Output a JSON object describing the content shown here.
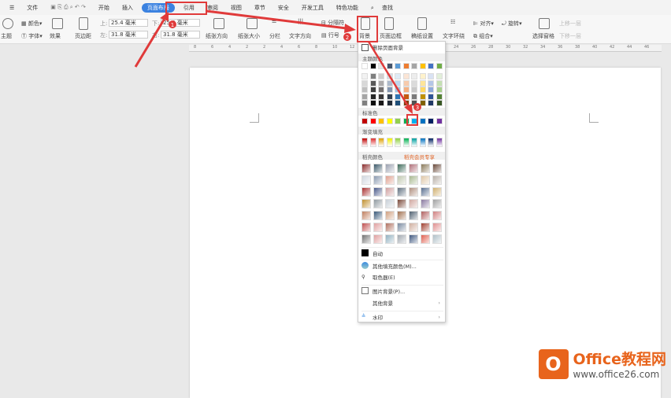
{
  "tabs": {
    "file": "文件",
    "items": [
      "开始",
      "插入",
      "页面布局",
      "引用",
      "审阅",
      "视图",
      "章节",
      "安全",
      "开发工具",
      "特色功能"
    ],
    "search": "查找"
  },
  "toolbar": {
    "theme": "主题",
    "colors": "颜色",
    "fonts": "字体",
    "effects": "效果",
    "margins": "页边距",
    "top_lbl": "上:",
    "top": "25.4 毫米",
    "bottom_lbl": "下:",
    "bottom": "25.4 毫米",
    "left_lbl": "左:",
    "left": "31.8 毫米",
    "right_lbl": "右:",
    "right": "31.8 毫米",
    "orientation": "纸张方向",
    "size": "纸张大小",
    "columns": "分栏",
    "text_direction": "文字方向",
    "breaks": "分隔符",
    "line_numbers": "行号",
    "background": "背景",
    "page_border": "页面边框",
    "paper_setup": "稿纸设置",
    "wrap": "文字环绕",
    "align": "对齐",
    "rotate": "旋转",
    "group": "组合",
    "selection_pane": "选择窗格",
    "bring_forward": "上移一层",
    "send_backward": "下移一层"
  },
  "ruler": [
    "8",
    "6",
    "4",
    "2",
    "2",
    "4",
    "6",
    "8",
    "10",
    "12",
    "14",
    "16",
    "18",
    "20",
    "22",
    "24",
    "26",
    "28",
    "30",
    "32",
    "34",
    "36",
    "38",
    "40",
    "42",
    "44",
    "46"
  ],
  "dropdown": {
    "delete_bg": "删除页面背景",
    "theme_colors": "主题颜色",
    "standard_colors": "标准色",
    "gradient": "渐变填充",
    "docer_colors": "稻壳颜色",
    "docer_member": "稻壳会员专享",
    "auto": "自动",
    "more_fill": "其他填充颜色(M)...",
    "picker": "取色器(E)",
    "picture_bg": "图片背景(P)...",
    "other_bg": "其他背景",
    "watermark": "水印"
  },
  "colors": {
    "theme": [
      "#ffffff",
      "#000000",
      "#e7e6e6",
      "#44546a",
      "#5b9bd5",
      "#ed7d31",
      "#a5a5a5",
      "#ffc000",
      "#4472c4",
      "#70ad47"
    ],
    "theme_shades": [
      [
        "#f2f2f2",
        "#7f7f7f",
        "#d0cece",
        "#d6dce4",
        "#deebf6",
        "#fbe5d5",
        "#ededed",
        "#fff2cc",
        "#d9e2f3",
        "#e2efd9"
      ],
      [
        "#d8d8d8",
        "#595959",
        "#aeabab",
        "#adb9ca",
        "#bdd7ee",
        "#f7cbac",
        "#dbdbdb",
        "#fee599",
        "#b4c6e7",
        "#c5e0b3"
      ],
      [
        "#bfbfbf",
        "#3f3f3f",
        "#757070",
        "#8496b0",
        "#9cc3e5",
        "#f4b183",
        "#c9c9c9",
        "#ffd965",
        "#8eaadb",
        "#a8d08d"
      ],
      [
        "#a5a5a5",
        "#262626",
        "#3a3838",
        "#323f4f",
        "#2e75b5",
        "#c55a11",
        "#7b7b7b",
        "#bf9000",
        "#2f5496",
        "#538135"
      ],
      [
        "#7f7f7f",
        "#0c0c0c",
        "#171616",
        "#222a35",
        "#1e4e79",
        "#833c0b",
        "#525252",
        "#7f6000",
        "#1f3864",
        "#375623"
      ]
    ],
    "standard": [
      "#c00000",
      "#ff0000",
      "#ffc000",
      "#ffff00",
      "#92d050",
      "#00b050",
      "#00b0f0",
      "#0070c0",
      "#002060",
      "#7030a0"
    ],
    "gradient": [
      "#c00000",
      "#e03030",
      "#e0a000",
      "#f0f000",
      "#90d040",
      "#00b050",
      "#00a0a0",
      "#0070c0",
      "#002060",
      "#7030a0"
    ],
    "docer": [
      [
        "#8b2c2c",
        "#3c5a6a",
        "#9aa0b0",
        "#3e6a5a",
        "#b0707a",
        "#8a7a5a",
        "#6a4a3a"
      ],
      [
        "#d0d8e0",
        "#8a9ab0",
        "#e0a090",
        "#c0c8b0",
        "#a8b890",
        "#e0c8a8",
        "#b8b0a8"
      ],
      [
        "#a83030",
        "#4a5a8a",
        "#d0a0a0",
        "#607080",
        "#b09080",
        "#5a7090",
        "#d0b070"
      ],
      [
        "#c09030",
        "#909aa0",
        "#c8d0d8",
        "#7a4a3a",
        "#d0a8a0",
        "#8a7aa0",
        "#a0a0a0"
      ],
      [
        "#c08060",
        "#3a5a7a",
        "#d0a080",
        "#a07050",
        "#506070",
        "#b06060",
        "#d08080"
      ],
      [
        "#c05050",
        "#e0a0a0",
        "#b07060",
        "#7a8aa0",
        "#d0b0a0",
        "#a04030",
        "#e09090"
      ],
      [
        "#707070",
        "#e0a0a0",
        "#90b0c0",
        "#a0a8b0",
        "#405880",
        "#e06050",
        "#b0c0c8"
      ]
    ]
  },
  "logo": {
    "brand": "Office教程网",
    "url": "www.office26.com"
  },
  "annotations": [
    "1",
    "2",
    "3"
  ],
  "accent": "#e03a3a"
}
